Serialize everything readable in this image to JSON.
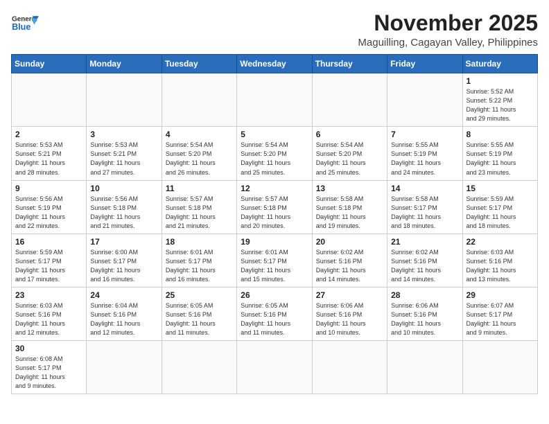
{
  "header": {
    "logo_general": "General",
    "logo_blue": "Blue",
    "month_title": "November 2025",
    "location": "Maguilling, Cagayan Valley, Philippines"
  },
  "weekdays": [
    "Sunday",
    "Monday",
    "Tuesday",
    "Wednesday",
    "Thursday",
    "Friday",
    "Saturday"
  ],
  "weeks": [
    [
      {
        "day": "",
        "info": ""
      },
      {
        "day": "",
        "info": ""
      },
      {
        "day": "",
        "info": ""
      },
      {
        "day": "",
        "info": ""
      },
      {
        "day": "",
        "info": ""
      },
      {
        "day": "",
        "info": ""
      },
      {
        "day": "1",
        "info": "Sunrise: 5:52 AM\nSunset: 5:22 PM\nDaylight: 11 hours\nand 29 minutes."
      }
    ],
    [
      {
        "day": "2",
        "info": "Sunrise: 5:53 AM\nSunset: 5:21 PM\nDaylight: 11 hours\nand 28 minutes."
      },
      {
        "day": "3",
        "info": "Sunrise: 5:53 AM\nSunset: 5:21 PM\nDaylight: 11 hours\nand 27 minutes."
      },
      {
        "day": "4",
        "info": "Sunrise: 5:54 AM\nSunset: 5:20 PM\nDaylight: 11 hours\nand 26 minutes."
      },
      {
        "day": "5",
        "info": "Sunrise: 5:54 AM\nSunset: 5:20 PM\nDaylight: 11 hours\nand 25 minutes."
      },
      {
        "day": "6",
        "info": "Sunrise: 5:54 AM\nSunset: 5:20 PM\nDaylight: 11 hours\nand 25 minutes."
      },
      {
        "day": "7",
        "info": "Sunrise: 5:55 AM\nSunset: 5:19 PM\nDaylight: 11 hours\nand 24 minutes."
      },
      {
        "day": "8",
        "info": "Sunrise: 5:55 AM\nSunset: 5:19 PM\nDaylight: 11 hours\nand 23 minutes."
      }
    ],
    [
      {
        "day": "9",
        "info": "Sunrise: 5:56 AM\nSunset: 5:19 PM\nDaylight: 11 hours\nand 22 minutes."
      },
      {
        "day": "10",
        "info": "Sunrise: 5:56 AM\nSunset: 5:18 PM\nDaylight: 11 hours\nand 21 minutes."
      },
      {
        "day": "11",
        "info": "Sunrise: 5:57 AM\nSunset: 5:18 PM\nDaylight: 11 hours\nand 21 minutes."
      },
      {
        "day": "12",
        "info": "Sunrise: 5:57 AM\nSunset: 5:18 PM\nDaylight: 11 hours\nand 20 minutes."
      },
      {
        "day": "13",
        "info": "Sunrise: 5:58 AM\nSunset: 5:18 PM\nDaylight: 11 hours\nand 19 minutes."
      },
      {
        "day": "14",
        "info": "Sunrise: 5:58 AM\nSunset: 5:17 PM\nDaylight: 11 hours\nand 18 minutes."
      },
      {
        "day": "15",
        "info": "Sunrise: 5:59 AM\nSunset: 5:17 PM\nDaylight: 11 hours\nand 18 minutes."
      }
    ],
    [
      {
        "day": "16",
        "info": "Sunrise: 5:59 AM\nSunset: 5:17 PM\nDaylight: 11 hours\nand 17 minutes."
      },
      {
        "day": "17",
        "info": "Sunrise: 6:00 AM\nSunset: 5:17 PM\nDaylight: 11 hours\nand 16 minutes."
      },
      {
        "day": "18",
        "info": "Sunrise: 6:01 AM\nSunset: 5:17 PM\nDaylight: 11 hours\nand 16 minutes."
      },
      {
        "day": "19",
        "info": "Sunrise: 6:01 AM\nSunset: 5:17 PM\nDaylight: 11 hours\nand 15 minutes."
      },
      {
        "day": "20",
        "info": "Sunrise: 6:02 AM\nSunset: 5:16 PM\nDaylight: 11 hours\nand 14 minutes."
      },
      {
        "day": "21",
        "info": "Sunrise: 6:02 AM\nSunset: 5:16 PM\nDaylight: 11 hours\nand 14 minutes."
      },
      {
        "day": "22",
        "info": "Sunrise: 6:03 AM\nSunset: 5:16 PM\nDaylight: 11 hours\nand 13 minutes."
      }
    ],
    [
      {
        "day": "23",
        "info": "Sunrise: 6:03 AM\nSunset: 5:16 PM\nDaylight: 11 hours\nand 12 minutes."
      },
      {
        "day": "24",
        "info": "Sunrise: 6:04 AM\nSunset: 5:16 PM\nDaylight: 11 hours\nand 12 minutes."
      },
      {
        "day": "25",
        "info": "Sunrise: 6:05 AM\nSunset: 5:16 PM\nDaylight: 11 hours\nand 11 minutes."
      },
      {
        "day": "26",
        "info": "Sunrise: 6:05 AM\nSunset: 5:16 PM\nDaylight: 11 hours\nand 11 minutes."
      },
      {
        "day": "27",
        "info": "Sunrise: 6:06 AM\nSunset: 5:16 PM\nDaylight: 11 hours\nand 10 minutes."
      },
      {
        "day": "28",
        "info": "Sunrise: 6:06 AM\nSunset: 5:16 PM\nDaylight: 11 hours\nand 10 minutes."
      },
      {
        "day": "29",
        "info": "Sunrise: 6:07 AM\nSunset: 5:17 PM\nDaylight: 11 hours\nand 9 minutes."
      }
    ],
    [
      {
        "day": "30",
        "info": "Sunrise: 6:08 AM\nSunset: 5:17 PM\nDaylight: 11 hours\nand 9 minutes."
      },
      {
        "day": "",
        "info": ""
      },
      {
        "day": "",
        "info": ""
      },
      {
        "day": "",
        "info": ""
      },
      {
        "day": "",
        "info": ""
      },
      {
        "day": "",
        "info": ""
      },
      {
        "day": "",
        "info": ""
      }
    ]
  ]
}
